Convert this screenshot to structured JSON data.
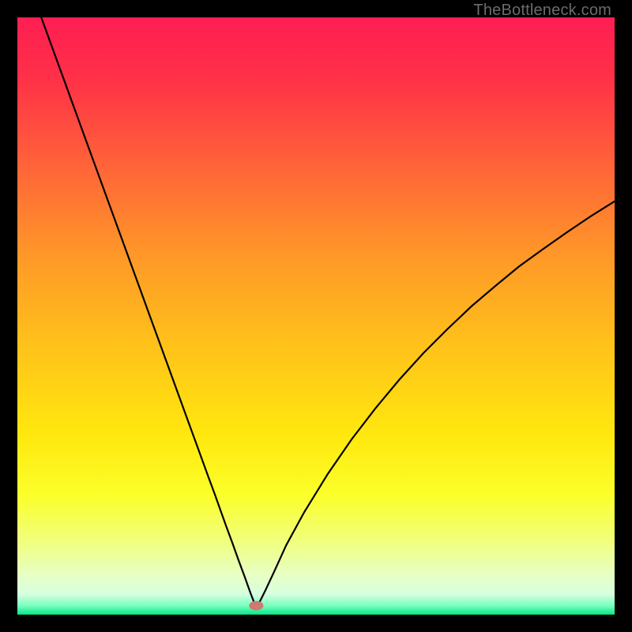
{
  "watermark": "TheBottleneck.com",
  "chart_data": {
    "type": "line",
    "title": "",
    "xlabel": "",
    "ylabel": "",
    "xlim": [
      0,
      100
    ],
    "ylim": [
      0,
      100
    ],
    "grid": false,
    "legend": false,
    "background_gradient": {
      "stops": [
        {
          "offset": 0.0,
          "color": "#ff1e52"
        },
        {
          "offset": 0.1,
          "color": "#ff3048"
        },
        {
          "offset": 0.25,
          "color": "#ff6438"
        },
        {
          "offset": 0.4,
          "color": "#ff9828"
        },
        {
          "offset": 0.55,
          "color": "#ffc21a"
        },
        {
          "offset": 0.7,
          "color": "#ffe80e"
        },
        {
          "offset": 0.8,
          "color": "#fbff2a"
        },
        {
          "offset": 0.88,
          "color": "#f0ff80"
        },
        {
          "offset": 0.93,
          "color": "#e8ffc0"
        },
        {
          "offset": 0.965,
          "color": "#d8ffe0"
        },
        {
          "offset": 0.985,
          "color": "#7affc0"
        },
        {
          "offset": 1.0,
          "color": "#00e884"
        }
      ]
    },
    "curve": {
      "x_values": [
        4,
        6,
        8,
        10,
        12,
        14,
        16,
        18,
        20,
        22,
        24,
        26,
        28,
        30,
        32,
        33,
        34,
        35,
        36,
        37,
        38,
        38.5,
        39,
        39.5,
        39.8,
        40.2,
        40.7,
        41.5,
        43,
        45,
        48,
        52,
        56,
        60,
        64,
        68,
        72,
        76,
        80,
        84,
        88,
        92,
        96,
        100
      ],
      "y_values": [
        100,
        94.5,
        89,
        83.5,
        78,
        72.5,
        67,
        61.5,
        56,
        50.5,
        45,
        39.5,
        34,
        28.5,
        23,
        20.3,
        17.5,
        14.7,
        12,
        9.2,
        6.5,
        5.1,
        3.7,
        2.4,
        1.5,
        1.5,
        2.4,
        4,
        7.2,
        11.6,
        17.1,
        23.6,
        29.4,
        34.6,
        39.4,
        43.8,
        47.8,
        51.6,
        55.0,
        58.3,
        61.2,
        64.0,
        66.7,
        69.2
      ]
    },
    "marker": {
      "x": 40,
      "y": 1.5,
      "color": "#cd7a72",
      "rx": 9,
      "ry": 6
    }
  }
}
